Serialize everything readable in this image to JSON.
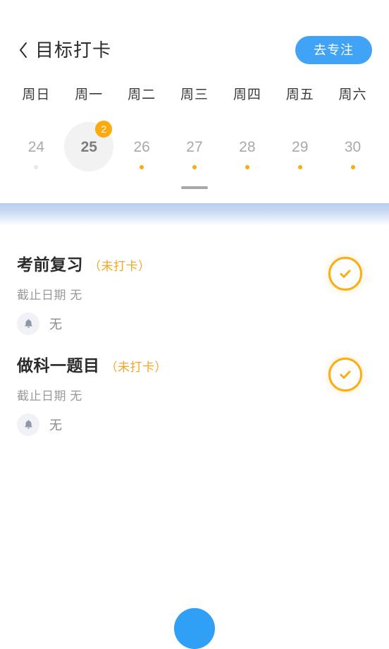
{
  "header": {
    "back_icon": "chevron-left-icon",
    "title": "目标打卡",
    "focus_button_label": "去专注",
    "accent_blue": "#40a3f5"
  },
  "calendar": {
    "weekdays": [
      "周日",
      "周一",
      "周二",
      "周三",
      "周四",
      "周五",
      "周六"
    ],
    "days": [
      {
        "num": "24",
        "selected": false,
        "dot": "faint",
        "badge": ""
      },
      {
        "num": "25",
        "selected": true,
        "dot": "none",
        "badge": "2"
      },
      {
        "num": "26",
        "selected": false,
        "dot": "orange",
        "badge": ""
      },
      {
        "num": "27",
        "selected": false,
        "dot": "orange",
        "badge": ""
      },
      {
        "num": "28",
        "selected": false,
        "dot": "orange",
        "badge": ""
      },
      {
        "num": "29",
        "selected": false,
        "dot": "orange",
        "badge": ""
      },
      {
        "num": "30",
        "selected": false,
        "dot": "orange",
        "badge": ""
      }
    ],
    "dot_color": "#fbab10",
    "badge_color": "#fbab10",
    "selected_circle_color": "#f2f2f2"
  },
  "drag_handle": {
    "name": "sheet-drag-handle"
  },
  "tasks": [
    {
      "title": "考前复习",
      "status": "（未打卡）",
      "deadline": "截止日期 无",
      "reminder_icon": "bell-icon",
      "reminder": "无",
      "check_icon": "check-circle-icon"
    },
    {
      "title": "做科一题目",
      "status": "（未打卡）",
      "deadline": "截止日期 无",
      "reminder_icon": "bell-icon",
      "reminder": "无",
      "check_icon": "check-circle-icon"
    }
  ],
  "fab": {
    "icon": "add-icon",
    "color": "#2fa0f5"
  },
  "colors": {
    "status_orange": "#f5a623",
    "check_orange": "#fbad12",
    "title_dark": "#2b2b2b",
    "muted_gray": "#9a9a9a"
  }
}
